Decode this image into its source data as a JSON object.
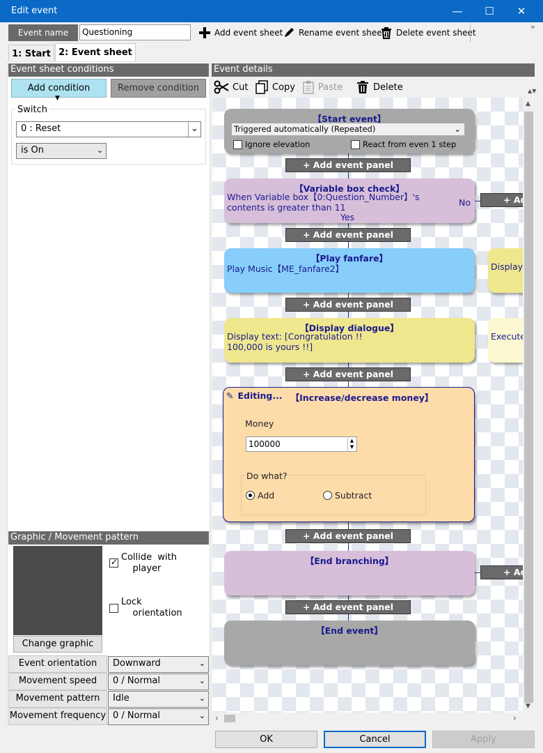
{
  "window": {
    "title": "Edit event",
    "minimize": "—",
    "maximize": "☐",
    "close": "✕"
  },
  "toolbar": {
    "event_name_label": "Event name",
    "event_name_value": "Questioning",
    "add_sheet": "Add event sheet",
    "rename_sheet": "Rename event sheet",
    "delete_sheet": "Delete event sheet",
    "overflow": "»"
  },
  "tabs": [
    {
      "label": "1: Start"
    },
    {
      "label": "2: Event sheet"
    }
  ],
  "conditions": {
    "header": "Event sheet conditions",
    "add": "Add condition",
    "remove": "Remove condition",
    "switch_label": "Switch",
    "switch_value": "0 : Reset",
    "state_value": "is On"
  },
  "graphic": {
    "header": "Graphic / Movement pattern",
    "collide": "Collide  with\n    player",
    "lock": "Lock\n    orientation",
    "change": "Change graphic"
  },
  "props": [
    {
      "label": "Event orientation",
      "value": "Downward"
    },
    {
      "label": "Movement speed",
      "value": "0 / Normal"
    },
    {
      "label": "Movement pattern",
      "value": "Idle"
    },
    {
      "label": "Movement frequency",
      "value": "0 / Normal"
    }
  ],
  "details": {
    "header": "Event details",
    "cut": "Cut",
    "copy": "Copy",
    "paste": "Paste",
    "delete": "Delete"
  },
  "flow": {
    "add_panel": "+ Add event panel",
    "add_short": "+ Ad",
    "start": {
      "title": "【Start event】",
      "trigger": "Triggered automatically (Repeated)",
      "ignore": "Ignore elevation",
      "react": "React from even 1 step"
    },
    "varcheck": {
      "title": "【Variable box check】",
      "body": "When Variable box【0:Question_Number】's contents is greater than 11",
      "no": "No",
      "yes": "Yes"
    },
    "fanfare": {
      "title": "【Play fanfare】",
      "body": "Play Music【ME_fanfare2】",
      "side": "Display"
    },
    "dialogue": {
      "title": "【Display dialogue】",
      "body": "Display text: [Congratulation !!\n100,000 is yours !!]",
      "side": "Execute"
    },
    "money": {
      "editing": "Editing...",
      "title": "【Increase/decrease money】",
      "money_label": "Money",
      "money_value": "100000",
      "do_what": "Do what?",
      "add": "Add",
      "subtract": "Subtract"
    },
    "endbranch": {
      "title": "【End branching】"
    },
    "endevent": {
      "title": "【End event】"
    }
  },
  "footer": {
    "ok": "OK",
    "cancel": "Cancel",
    "apply": "Apply"
  },
  "colors": {
    "titlebar": "#0a6ac6",
    "start": "#a8a8a8",
    "varcheck": "#d7bfda",
    "fanfare": "#87cefa",
    "dialogue": "#efe78e",
    "money": "#fddcaa",
    "endbranch": "#d7bfda",
    "endevent": "#a8a8a8"
  }
}
